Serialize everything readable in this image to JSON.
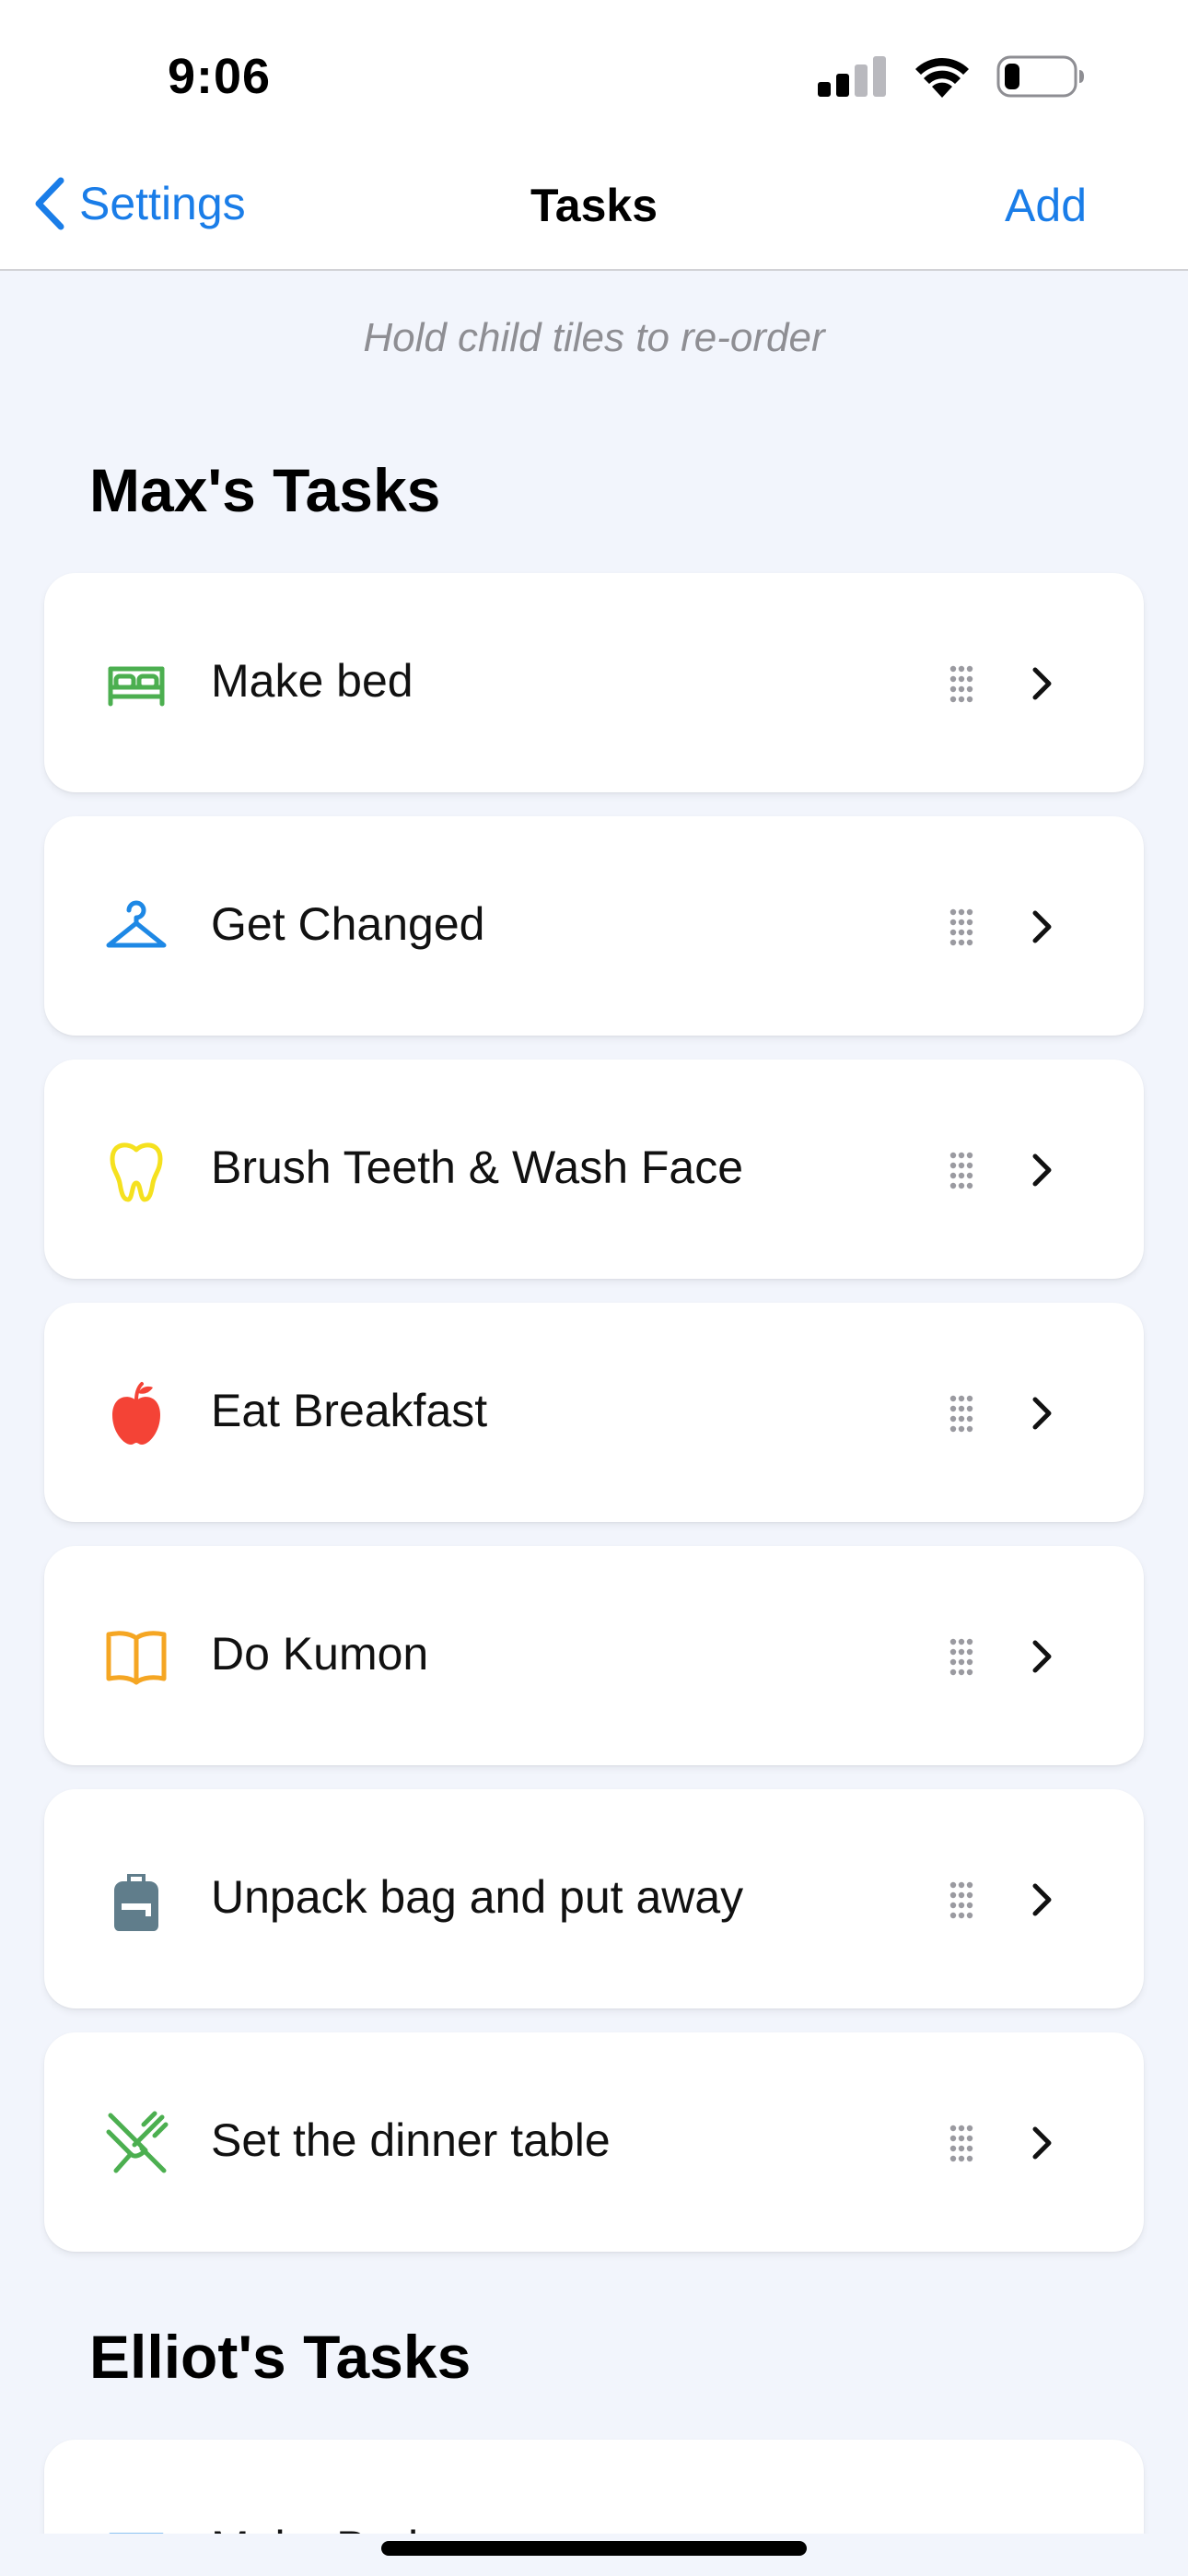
{
  "status_bar": {
    "time": "9:06",
    "icons": [
      "signal-icon",
      "wifi-icon",
      "battery-icon"
    ]
  },
  "nav": {
    "back_label": "Settings",
    "title": "Tasks",
    "add_label": "Add"
  },
  "hint": "Hold child tiles to re-order",
  "sections": [
    {
      "title": "Max's Tasks",
      "tasks": [
        {
          "label": "Make bed",
          "icon": "bed-icon",
          "icon_color": "#4caf50"
        },
        {
          "label": "Get Changed",
          "icon": "hanger-icon",
          "icon_color": "#1e88e5"
        },
        {
          "label": "Brush Teeth & Wash Face",
          "icon": "tooth-icon",
          "icon_color": "#f5e11f"
        },
        {
          "label": "Eat Breakfast",
          "icon": "apple-icon",
          "icon_color": "#f44336"
        },
        {
          "label": "Do Kumon",
          "icon": "book-icon",
          "icon_color": "#f5a623"
        },
        {
          "label": "Unpack bag and put away",
          "icon": "backpack-icon",
          "icon_color": "#607d8b"
        },
        {
          "label": "Set the dinner table",
          "icon": "utensils-icon",
          "icon_color": "#4caf50"
        }
      ]
    },
    {
      "title": "Elliot's Tasks",
      "tasks": [
        {
          "label": "Make Bed",
          "icon": "bed-icon",
          "icon_color": "#1e88e5"
        }
      ]
    }
  ],
  "colors": {
    "accent": "#1a7de8",
    "background": "#f2f5fc",
    "card": "#ffffff"
  }
}
